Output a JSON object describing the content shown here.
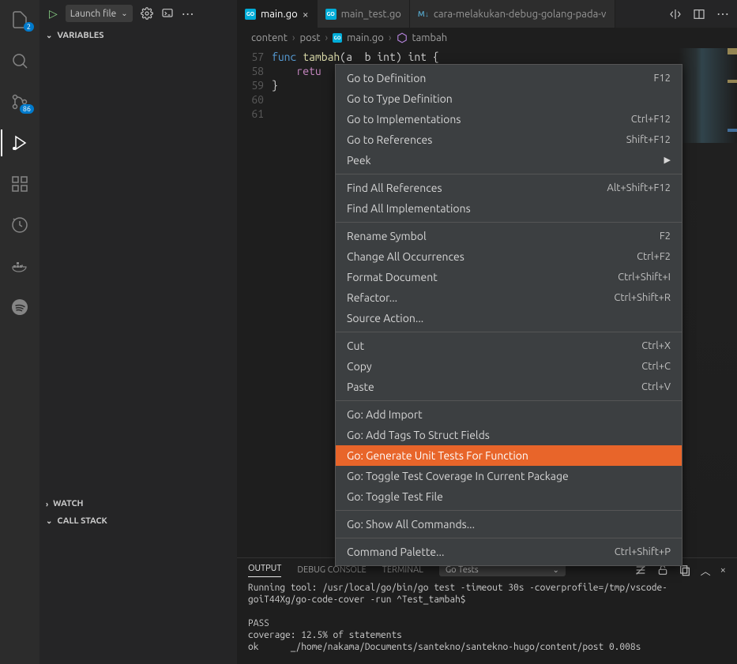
{
  "activityBar": {
    "explorerBadge": "2",
    "scmBadge": "86"
  },
  "sidebar": {
    "launchLabel": "Launch file",
    "sections": {
      "variables": "VARIABLES",
      "watch": "WATCH",
      "callStack": "CALL STACK"
    }
  },
  "tabs": [
    {
      "label": "main.go",
      "active": true,
      "type": "go"
    },
    {
      "label": "main_test.go",
      "active": false,
      "type": "go"
    },
    {
      "label": "cara-melakukan-debug-golang-pada-vsc",
      "active": false,
      "type": "md"
    }
  ],
  "breadcrumb": {
    "parts": [
      "content",
      "post",
      "main.go",
      "tambah"
    ]
  },
  "editor": {
    "lines": [
      {
        "n": "57",
        "text": ""
      },
      {
        "n": "58",
        "html": "<span class='kw2'>func</span> <span class='fn'>tambah</span>(a  b int) int {"
      },
      {
        "n": "59",
        "html": "    <span class='ctrl'>retu</span>"
      },
      {
        "n": "60",
        "text": "}"
      },
      {
        "n": "61",
        "text": ""
      }
    ]
  },
  "contextMenu": {
    "groups": [
      [
        {
          "label": "Go to Definition",
          "shortcut": "F12"
        },
        {
          "label": "Go to Type Definition",
          "shortcut": ""
        },
        {
          "label": "Go to Implementations",
          "shortcut": "Ctrl+F12"
        },
        {
          "label": "Go to References",
          "shortcut": "Shift+F12"
        },
        {
          "label": "Peek",
          "submenu": true
        }
      ],
      [
        {
          "label": "Find All References",
          "shortcut": "Alt+Shift+F12"
        },
        {
          "label": "Find All Implementations",
          "shortcut": ""
        }
      ],
      [
        {
          "label": "Rename Symbol",
          "shortcut": "F2"
        },
        {
          "label": "Change All Occurrences",
          "shortcut": "Ctrl+F2"
        },
        {
          "label": "Format Document",
          "shortcut": "Ctrl+Shift+I"
        },
        {
          "label": "Refactor...",
          "shortcut": "Ctrl+Shift+R"
        },
        {
          "label": "Source Action...",
          "shortcut": ""
        }
      ],
      [
        {
          "label": "Cut",
          "shortcut": "Ctrl+X"
        },
        {
          "label": "Copy",
          "shortcut": "Ctrl+C"
        },
        {
          "label": "Paste",
          "shortcut": "Ctrl+V"
        }
      ],
      [
        {
          "label": "Go: Add Import",
          "shortcut": ""
        },
        {
          "label": "Go: Add Tags To Struct Fields",
          "shortcut": ""
        },
        {
          "label": "Go: Generate Unit Tests For Function",
          "shortcut": "",
          "highlight": true
        },
        {
          "label": "Go: Toggle Test Coverage In Current Package",
          "shortcut": ""
        },
        {
          "label": "Go: Toggle Test File",
          "shortcut": ""
        }
      ],
      [
        {
          "label": "Go: Show All Commands...",
          "shortcut": ""
        }
      ],
      [
        {
          "label": "Command Palette...",
          "shortcut": "Ctrl+Shift+P"
        }
      ]
    ]
  },
  "panel": {
    "tabs": {
      "output": "OUTPUT",
      "debug": "DEBUG CONSOLE",
      "terminal": "TERMINAL"
    },
    "channel": "Go Tests",
    "output": "Running tool: /usr/local/go/bin/go test -timeout 30s -coverprofile=/tmp/vscode-goiT44Xg/go-code-cover -run ^Test_tambah$\n\nPASS\ncoverage: 12.5% of statements\nok      _/home/nakama/Documents/santekno/santekno-hugo/content/post 0.008s"
  }
}
